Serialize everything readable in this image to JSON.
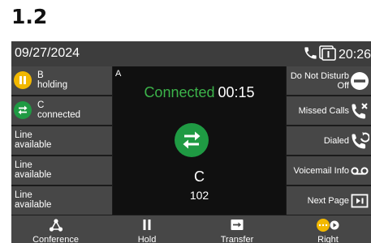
{
  "step_number": "1.2",
  "status_bar": {
    "date": "09/27/2024",
    "time": "20:26"
  },
  "lines": [
    {
      "label": "B",
      "state": "holding",
      "icon": "pause-icon",
      "color": "#f2b800"
    },
    {
      "label": "C",
      "state": "connected",
      "icon": "transfer-arrows-icon",
      "color": "#1f9a43"
    },
    {
      "label": "Line",
      "state": "available"
    },
    {
      "label": "Line",
      "state": "available"
    },
    {
      "label": "Line",
      "state": "available"
    }
  ],
  "call": {
    "line_id": "A",
    "status": "Connected",
    "timer": "00:15",
    "contact_name": "C",
    "contact_number": "102",
    "status_color": "#3cb34a"
  },
  "softkeys": [
    {
      "line1": "Do Not Disturb",
      "line2": "Off",
      "icon": "do-not-disturb-icon"
    },
    {
      "line1": "Missed Calls",
      "icon": "missed-calls-icon"
    },
    {
      "line1": "Dialed",
      "icon": "dialed-calls-icon"
    },
    {
      "line1": "Voicemail Info",
      "icon": "voicemail-icon"
    },
    {
      "line1": "Next Page",
      "icon": "next-page-icon"
    }
  ],
  "bottom_bar": [
    {
      "label": "Conference",
      "icon": "conference-icon"
    },
    {
      "label": "Hold",
      "icon": "hold-icon"
    },
    {
      "label": "Transfer",
      "icon": "transfer-icon"
    },
    {
      "label": "Right",
      "icon": "more-options-icon"
    }
  ]
}
